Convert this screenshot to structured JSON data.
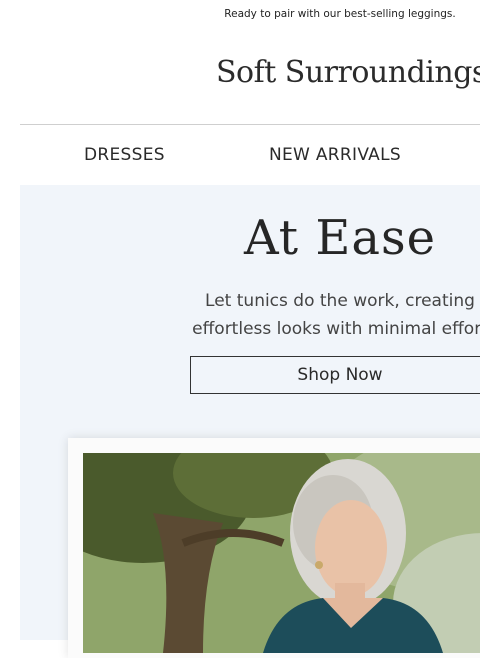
{
  "preheader": "Ready to pair with our best-selling leggings.",
  "brand": {
    "name": "Soft Surroundings",
    "mark": "®"
  },
  "nav": {
    "items": [
      "DRESSES",
      "NEW ARRIVALS"
    ]
  },
  "hero": {
    "title": "At Ease",
    "copy_line1": "Let tunics do the work, creating",
    "copy_line2": "effortless looks with minimal effort",
    "cta": "Shop Now"
  },
  "colors": {
    "hero_bg": "#f1f5fa",
    "text": "#262626",
    "divider": "#cfcfcf"
  }
}
